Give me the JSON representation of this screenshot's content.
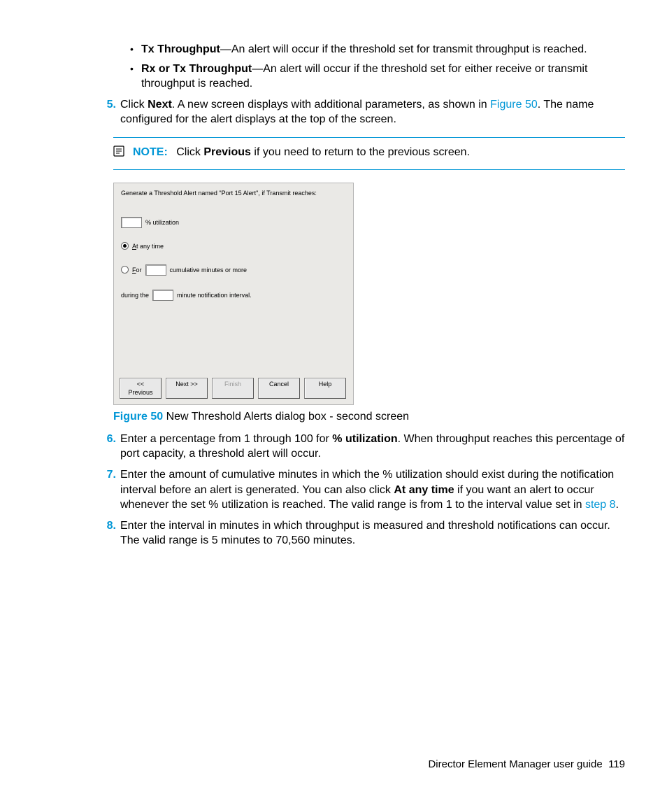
{
  "bullets": [
    {
      "bold": "Tx Throughput",
      "rest": "—An alert will occur if the threshold set for transmit throughput is reached."
    },
    {
      "bold": "Rx or Tx Throughput",
      "rest": "—An alert will occur if the threshold set for either receive or transmit throughput is reached."
    }
  ],
  "step5": {
    "num": "5.",
    "pre": "Click ",
    "b1": "Next",
    "mid": ". A new screen displays with additional parameters, as shown in ",
    "link": "Figure 50",
    "post": ". The name configured for the alert displays at the top of the screen."
  },
  "note": {
    "label": "NOTE:",
    "pre": "Click ",
    "bold": "Previous",
    "post": " if you need to return to the previous screen."
  },
  "dialog": {
    "header": "Generate a Threshold Alert named \"Port 15 Alert\",  if Transmit reaches:",
    "util_label": "% utilization",
    "at_any_time_pre": "A",
    "at_any_time_rest": "t any time",
    "for_pre": "F",
    "for_rest": "or",
    "for_post": "cumulative minutes or more",
    "during_pre": "during the",
    "during_post": "minute notification interval.",
    "btn_prev": "<< Previous",
    "btn_next": "Next >>",
    "btn_finish": "Finish",
    "btn_cancel": "Cancel",
    "btn_help": "Help"
  },
  "figure": {
    "num": "Figure 50",
    "caption": " New Threshold Alerts dialog box - second screen"
  },
  "step6": {
    "num": "6.",
    "pre": "Enter a percentage from 1 through 100 for ",
    "bold": "% utilization",
    "post": ". When throughput reaches this percentage of port capacity, a threshold alert will occur."
  },
  "step7": {
    "num": "7.",
    "pre": "Enter the amount of cumulative minutes in which the % utilization should exist during the notification interval before an alert is generated. You can also click ",
    "bold": "At any time",
    "mid": " if you want an alert to occur whenever the set % utilization is reached. The valid range is from 1 to the interval value set in ",
    "link": "step 8",
    "post": "."
  },
  "step8": {
    "num": "8.",
    "text": "Enter the interval in minutes in which throughput is measured and threshold notifications can occur. The valid range is 5 minutes to 70,560 minutes."
  },
  "footer": {
    "title": "Director Element Manager user guide",
    "page": "119"
  }
}
